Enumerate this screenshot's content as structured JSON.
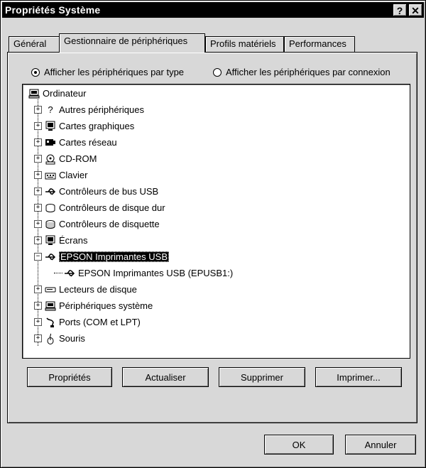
{
  "window": {
    "title": "Propriétés Système",
    "help_button": "?",
    "close_button": "✕"
  },
  "tabs": [
    {
      "label": "Général",
      "active": false
    },
    {
      "label": "Gestionnaire de périphériques",
      "active": true
    },
    {
      "label": "Profils matériels",
      "active": false
    },
    {
      "label": "Performances",
      "active": false
    }
  ],
  "view_options": {
    "by_type": {
      "label": "Afficher les périphériques par type",
      "selected": true
    },
    "by_connection": {
      "label": "Afficher les périphériques par connexion",
      "selected": false
    }
  },
  "tree": {
    "root": {
      "label": "Ordinateur",
      "icon": "computer-icon"
    },
    "items": [
      {
        "label": "Autres périphériques",
        "icon": "question-icon",
        "expander": "+"
      },
      {
        "label": "Cartes graphiques",
        "icon": "monitor-icon",
        "expander": "+"
      },
      {
        "label": "Cartes réseau",
        "icon": "network-card-icon",
        "expander": "+"
      },
      {
        "label": "CD-ROM",
        "icon": "cdrom-icon",
        "expander": "+"
      },
      {
        "label": "Clavier",
        "icon": "keyboard-icon",
        "expander": "+"
      },
      {
        "label": "Contrôleurs de bus USB",
        "icon": "usb-icon",
        "expander": "+"
      },
      {
        "label": "Contrôleurs de disque dur",
        "icon": "hard-disk-icon",
        "expander": "+"
      },
      {
        "label": "Contrôleurs de disquette",
        "icon": "floppy-icon",
        "expander": "+"
      },
      {
        "label": "Écrans",
        "icon": "monitor-icon",
        "expander": "+"
      },
      {
        "label": "EPSON Imprimantes USB",
        "icon": "usb-icon",
        "expander": "−",
        "selected": true
      },
      {
        "label": "EPSON Imprimantes USB (EPUSB1:)",
        "icon": "usb-icon",
        "child": true
      },
      {
        "label": "Lecteurs de disque",
        "icon": "drive-icon",
        "expander": "+"
      },
      {
        "label": "Périphériques système",
        "icon": "computer-icon",
        "expander": "+"
      },
      {
        "label": "Ports (COM et LPT)",
        "icon": "port-icon",
        "expander": "+"
      },
      {
        "label": "Souris",
        "icon": "mouse-icon",
        "expander": "+"
      }
    ]
  },
  "buttons": {
    "properties": "Propriétés",
    "refresh": "Actualiser",
    "remove": "Supprimer",
    "print": "Imprimer..."
  },
  "dialog_buttons": {
    "ok": "OK",
    "cancel": "Annuler"
  },
  "colors": {
    "face": "#d8d8d8",
    "selection": "#000000",
    "title_bar": "#000000"
  }
}
